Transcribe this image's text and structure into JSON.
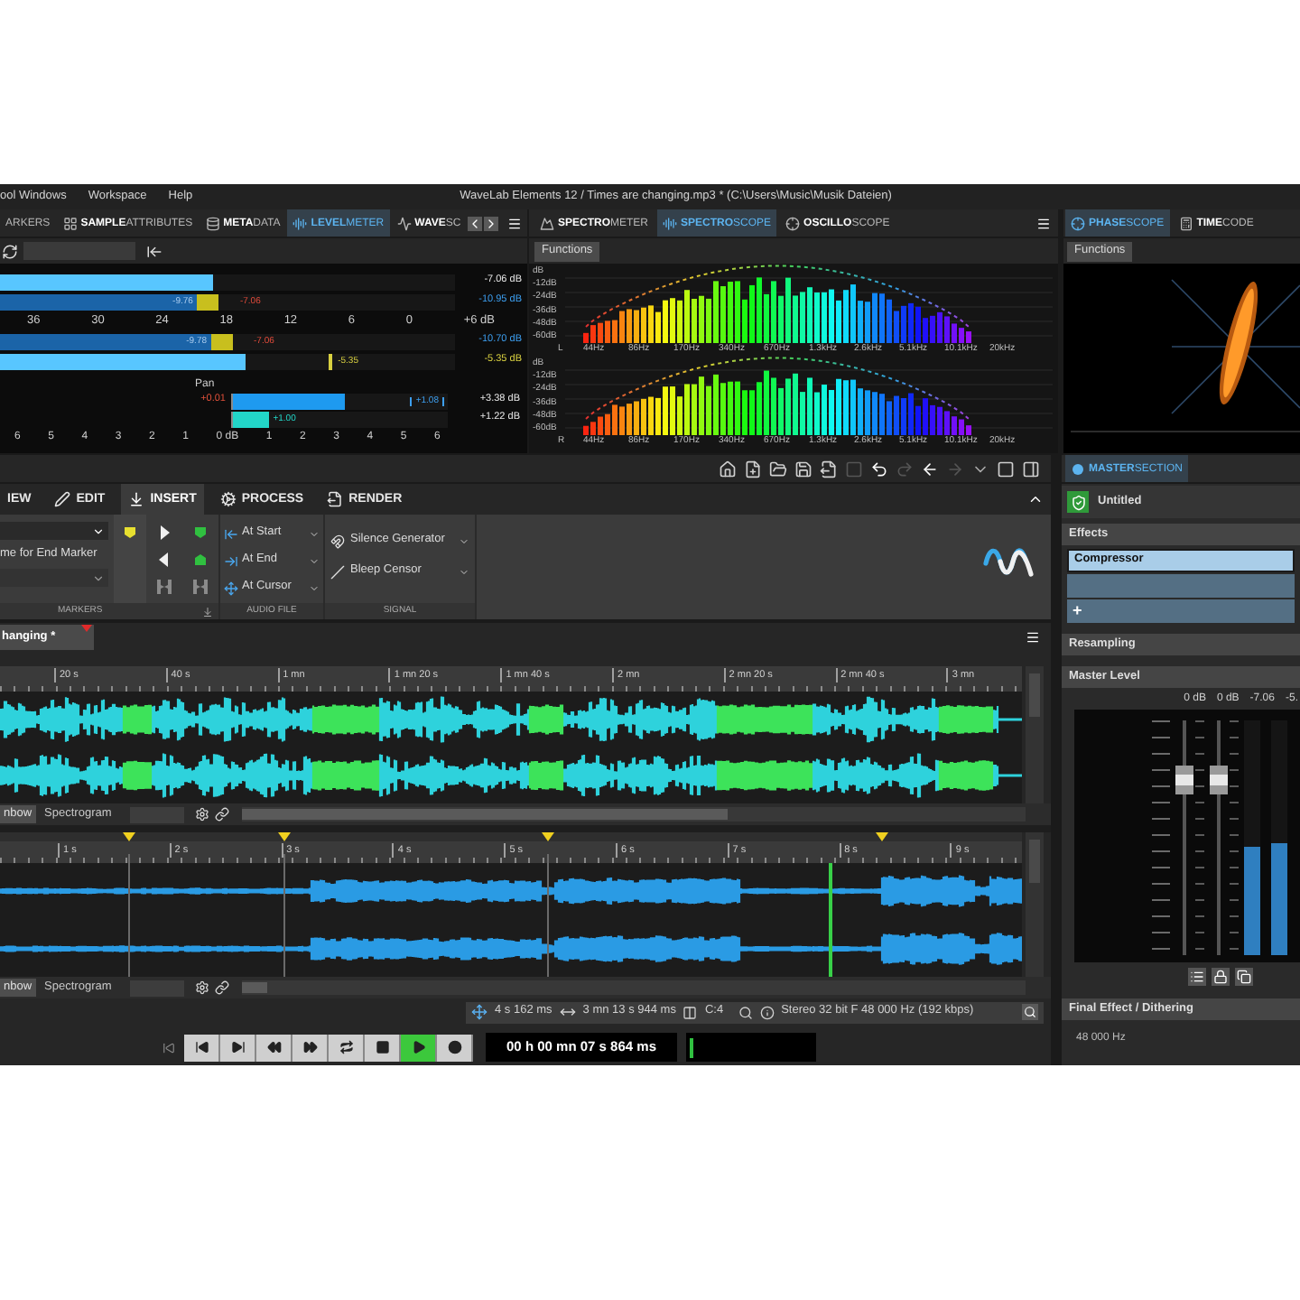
{
  "menu_bar": {
    "items": [
      "ool Windows",
      "Workspace",
      "Help"
    ],
    "title": "WaveLab Elements 12 / Times are changing.mp3 * (C:\\Users\\Music\\Musik Dateien)"
  },
  "level_panel": {
    "tabs": [
      {
        "label": "ARKERS",
        "selected": false
      },
      {
        "label": "**SAMPLE**ATTRIBUTES",
        "selected": false
      },
      {
        "label": "**META**DATA",
        "selected": false
      },
      {
        "label": "**LEVEL**METER",
        "selected": true
      },
      {
        "label": "**WAVE**SC",
        "selected": false
      }
    ],
    "rows": [
      {
        "kind": "peak",
        "level": 0.47,
        "reading": "-7.06 dB"
      },
      {
        "kind": "rms",
        "level": 0.48,
        "value": "-9.76",
        "hold": "-7.06",
        "reading": "-10.95 dB"
      },
      {
        "kind": "scale",
        "labels": [
          "36",
          "30",
          "24",
          "18",
          "12",
          "6",
          "0",
          "+6 dB"
        ]
      },
      {
        "kind": "rms",
        "level": 0.51,
        "value": "-9.78",
        "hold": "-7.06",
        "reading": "-10.70 dB"
      },
      {
        "kind": "peak",
        "level": 0.54,
        "hold": "-5.35",
        "reading": "-5.35 dB"
      }
    ],
    "pan": {
      "label": "Pan",
      "rows": [
        {
          "kind": "left",
          "level": 0.52,
          "offset": "+0.01",
          "box": "+1.08",
          "reading": "+3.38 dB"
        },
        {
          "kind": "right",
          "level": 0.17,
          "value": "+1.00",
          "reading": "+1.22 dB"
        }
      ],
      "scale": [
        "6",
        "5",
        "4",
        "3",
        "2",
        "1",
        "0 dB",
        "1",
        "2",
        "3",
        "4",
        "5",
        "6"
      ]
    }
  },
  "spectro_panel": {
    "tabs": [
      {
        "label": "**SPECTRO**METER",
        "selected": false
      },
      {
        "label": "**SPECTRO**SCOPE",
        "selected": true
      },
      {
        "label": "**OSCILLO**SCOPE",
        "selected": false
      }
    ],
    "functions": "Functions",
    "charts": [
      {
        "channel": "L",
        "db_labels": [
          "dB",
          "-12dB",
          "-24dB",
          "-36dB",
          "-48dB",
          "-60dB"
        ],
        "freq_labels": [
          "44Hz",
          "86Hz",
          "170Hz",
          "340Hz",
          "670Hz",
          "1.3kHz",
          "2.6kHz",
          "5.1kHz",
          "10.1kHz",
          "20kHz"
        ]
      },
      {
        "channel": "R",
        "db_labels": [
          "dB",
          "-12dB",
          "-24dB",
          "-36dB",
          "-48dB",
          "-60dB"
        ],
        "freq_labels": [
          "44Hz",
          "86Hz",
          "170Hz",
          "340Hz",
          "670Hz",
          "1.3kHz",
          "2.6kHz",
          "5.1kHz",
          "10.1kHz",
          "20kHz"
        ]
      }
    ]
  },
  "phase_panel": {
    "tabs": [
      {
        "label": "**PHASE**SCOPE",
        "selected": true
      },
      {
        "label": "**TIME**CODE",
        "selected": false
      }
    ],
    "functions": "Functions"
  },
  "ribbon": {
    "tabs": [
      {
        "label": "IEW",
        "selected": false
      },
      {
        "label": "EDIT",
        "selected": false
      },
      {
        "label": "INSERT",
        "selected": true
      },
      {
        "label": "PROCESS",
        "selected": false
      },
      {
        "label": "RENDER",
        "selected": false
      }
    ],
    "groups": [
      {
        "kind": "markers",
        "name": "MARKERS",
        "field_text": "me for End Marker"
      },
      {
        "kind": "audio_file",
        "name": "AUDIO FILE",
        "items": [
          "At Start",
          "At End",
          "At Cursor"
        ]
      },
      {
        "kind": "signal",
        "name": "SIGNAL",
        "items": [
          "Silence Generator",
          "Bleep Censor"
        ]
      }
    ]
  },
  "wave_window": {
    "file_tab": "hanging *",
    "overview": {
      "ruler": [
        "20 s",
        "40 s",
        "1 mn",
        "1 mn 20 s",
        "1 mn 40 s",
        "2 mn",
        "2 mn 20 s",
        "2 mn 40 s",
        "3 mn"
      ],
      "view_tabs": [
        {
          "label": "nbow",
          "selected": true
        },
        {
          "label": "Spectrogram",
          "selected": false
        }
      ]
    },
    "main": {
      "ruler": [
        "1 s",
        "2 s",
        "3 s",
        "4 s",
        "5 s",
        "6 s",
        "7 s",
        "8 s",
        "9 s"
      ],
      "view_tabs": [
        {
          "label": "nbow",
          "selected": true
        },
        {
          "label": "Spectrogram",
          "selected": false
        }
      ]
    },
    "status": {
      "position": "4 s 162 ms",
      "length": "3 mn 13 s 944 ms",
      "zoom": "C:4",
      "format": "Stereo 32 bit F 48 000 Hz (192 kbps)"
    }
  },
  "transport": {
    "buttons": [
      {
        "kind": "start",
        "selected": false
      },
      {
        "kind": "end",
        "selected": false
      },
      {
        "kind": "rewind",
        "selected": false
      },
      {
        "kind": "forward",
        "selected": false
      },
      {
        "kind": "loop",
        "selected": false
      },
      {
        "kind": "stop",
        "selected": false
      },
      {
        "kind": "play",
        "selected": true
      },
      {
        "kind": "record",
        "selected": false
      }
    ],
    "time": "00 h 00 mn 07 s 864 ms"
  },
  "master_section": {
    "tab": {
      "label": "**MASTER**SECTION",
      "selected": true
    },
    "preset": "Untitled",
    "effects_title": "Effects",
    "slots": [
      {
        "kind": "plugin",
        "label": "Compressor",
        "selected": true
      },
      {
        "kind": "empty",
        "selected": false
      },
      {
        "kind": "add",
        "label": "+",
        "selected": false
      }
    ],
    "resampling_title": "Resampling",
    "level_title": "Master Level",
    "readings": [
      "0 dB",
      "0 dB",
      "-7.06",
      "-5."
    ],
    "faders": [
      {
        "level": 0.75
      },
      {
        "level": 0.75
      }
    ],
    "meters": [
      {
        "level": 0.46
      },
      {
        "level": 0.48
      }
    ],
    "final_title": "Final Effect / Dithering",
    "sample_rate": "48 000 Hz"
  }
}
